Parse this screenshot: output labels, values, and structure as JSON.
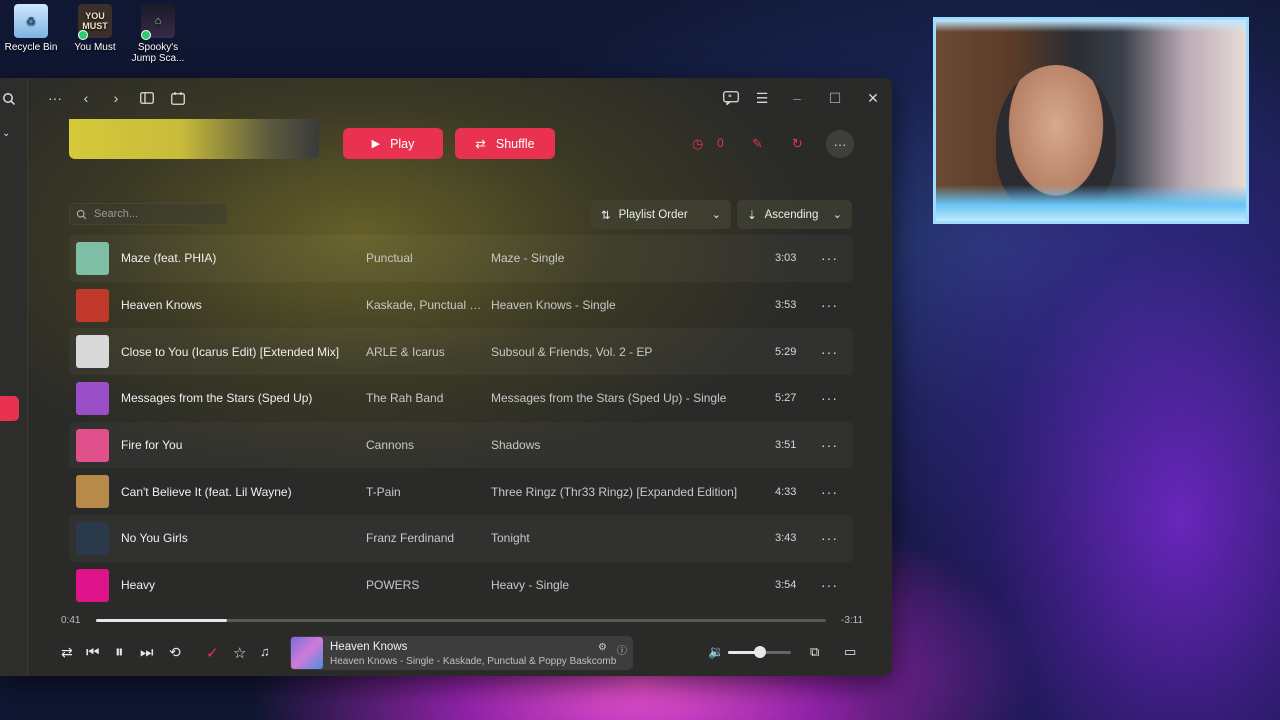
{
  "desktop": {
    "icons": [
      {
        "label": "Recycle Bin"
      },
      {
        "label": "You Must",
        "glyph_text": "YOU MUST"
      },
      {
        "label": "Spooky's Jump Sca..."
      }
    ]
  },
  "colors": {
    "accent": "#e8324f",
    "window_bg": "#2a2a28"
  },
  "header": {
    "play_label": "Play",
    "shuffle_label": "Shuffle",
    "stat_count": "0"
  },
  "search": {
    "placeholder": "Search..."
  },
  "sort": {
    "order_label": "Playlist Order",
    "direction_label": "Ascending"
  },
  "tracks": [
    {
      "title": "Maze (feat. PHIA)",
      "artist": "Punctual",
      "album": "Maze - Single",
      "duration": "3:03",
      "art_color": "#7fbfa5"
    },
    {
      "title": "Heaven Knows",
      "artist": "Kaskade, Punctual & Poppy Baskcomb",
      "album": "Heaven Knows - Single",
      "duration": "3:53",
      "art_color": "#c0392b"
    },
    {
      "title": "Close to You (Icarus Edit) [Extended Mix]",
      "artist": "ARLE & Icarus",
      "album": "Subsoul & Friends, Vol. 2 - EP",
      "duration": "5:29",
      "art_color": "#d9d9d9"
    },
    {
      "title": "Messages from the Stars (Sped Up)",
      "artist": "The Rah Band",
      "album": "Messages from the Stars (Sped Up) - Single",
      "duration": "5:27",
      "art_color": "#9a4fc9"
    },
    {
      "title": "Fire for You",
      "artist": "Cannons",
      "album": "Shadows",
      "duration": "3:51",
      "art_color": "#e0508a"
    },
    {
      "title": "Can't Believe It (feat. Lil Wayne)",
      "artist": "T-Pain",
      "album": "Three Ringz (Thr33 Ringz) [Expanded Edition]",
      "duration": "4:33",
      "art_color": "#b88a4a"
    },
    {
      "title": "No You Girls",
      "artist": "Franz Ferdinand",
      "album": "Tonight",
      "duration": "3:43",
      "art_color": "#2a3a4a"
    },
    {
      "title": "Heavy",
      "artist": "POWERS",
      "album": "Heavy - Single",
      "duration": "3:54",
      "art_color": "#e0148a"
    }
  ],
  "playback": {
    "elapsed": "0:41",
    "remaining": "-3:11",
    "progress_fraction": 0.18,
    "volume_fraction": 0.5
  },
  "now_playing": {
    "title": "Heaven Knows",
    "subtitle": "Heaven Knows - Single - Kaskade, Punctual & Poppy Baskcomb"
  }
}
